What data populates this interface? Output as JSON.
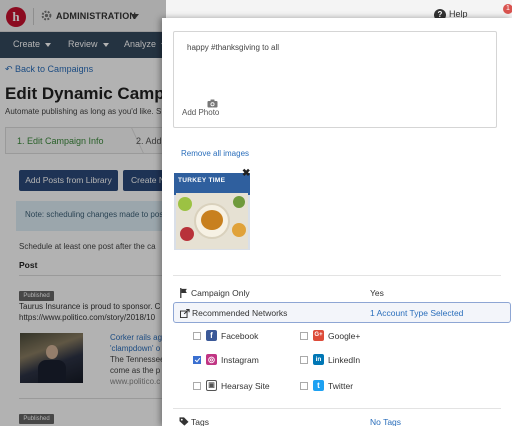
{
  "topbar": {
    "logo_letter": "h",
    "admin_label": "ADMINISTRATION",
    "help_label": "Help",
    "notification_count": "1"
  },
  "nav": {
    "items": [
      {
        "label": "Create"
      },
      {
        "label": "Review"
      },
      {
        "label": "Analyze"
      }
    ]
  },
  "page": {
    "back_link": "Back to Campaigns",
    "title": "Edit Dynamic Campaig",
    "subtitle": "Automate publishing as long as you'd like. S",
    "steps": [
      {
        "label": "1. Edit Campaign Info"
      },
      {
        "label": "2. Add"
      }
    ],
    "btn_add_library": "Add Posts from Library",
    "btn_create_new": "Create N",
    "note": "Note: scheduling changes made to posts",
    "schedule_hint": "Schedule at least one post after the ca",
    "post_header": "Post",
    "posts": [
      {
        "badge": "Published",
        "line1": "Taurus Insurance is proud to sponsor. C",
        "line2": "https://www.politico.com/story/2018/10"
      },
      {
        "badge": "",
        "link1": "Corker rails ag",
        "link2": "'clampdown' o",
        "text1": "The Tennessee",
        "text2": "come as the p",
        "url": "www.politico.c"
      },
      {
        "badge": "Published"
      }
    ]
  },
  "panel": {
    "compose_text": "happy #thanksgiving to all",
    "add_photo": "Add Photo",
    "remove_all": "Remove all images",
    "image_title": "TURKEY TIME",
    "rows": {
      "campaign_only": {
        "label": "Campaign Only",
        "value": "Yes"
      },
      "recommended": {
        "label": "Recommended Networks",
        "value": "1 Account Type Selected"
      },
      "tags": {
        "label": "Tags",
        "value": "No Tags"
      }
    },
    "networks": [
      {
        "name": "Facebook",
        "checked": false,
        "color": "#3b5998",
        "glyph": "f"
      },
      {
        "name": "Google+",
        "checked": false,
        "color": "#dd4b39",
        "glyph": "G+"
      },
      {
        "name": "Instagram",
        "checked": true,
        "color": "#c13584",
        "glyph": "◎"
      },
      {
        "name": "LinkedIn",
        "checked": false,
        "color": "#0077b5",
        "glyph": "in"
      },
      {
        "name": "Hearsay Site",
        "checked": false,
        "color": "#555555",
        "glyph": "▣"
      },
      {
        "name": "Twitter",
        "checked": false,
        "color": "#1da1f2",
        "glyph": "t"
      }
    ]
  }
}
